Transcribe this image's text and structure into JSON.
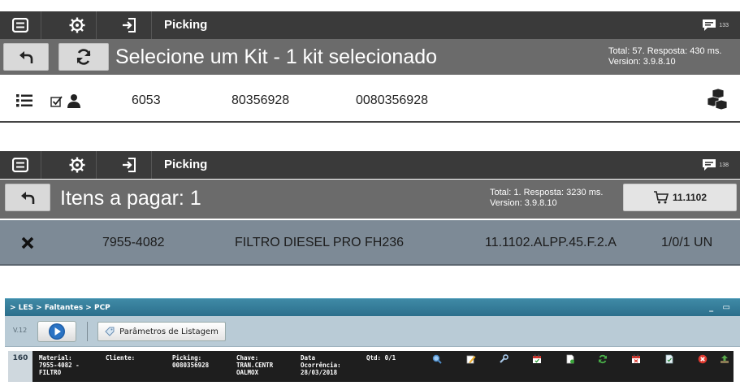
{
  "panel1": {
    "topbar": {
      "title": "Picking",
      "badge": "133",
      "icons": [
        "menu-icon",
        "gear-icon",
        "sign-in-icon",
        "chat-icon"
      ]
    },
    "header": {
      "title": "Selecione um Kit - 1 kit selecionado",
      "info_line1": "Total: 57. Resposta: 430 ms.",
      "info_line2": "Version: 3.9.8.10"
    },
    "row": {
      "code": "6053",
      "material": "80356928",
      "picking": "0080356928"
    }
  },
  "panel2": {
    "topbar": {
      "title": "Picking",
      "badge": "138"
    },
    "header": {
      "title": "Itens a pagar: 1",
      "info_line1": "Total: 1. Resposta: 3230 ms.",
      "info_line2": "Version: 3.9.8.10",
      "cart_label": "11.1102"
    },
    "row": {
      "part": "7955-4082",
      "description": "FILTRO DIESEL PRO FH236",
      "location": "11.1102.ALPP.45.F.2.A",
      "quantity": "1/0/1 UN"
    }
  },
  "panel3": {
    "breadcrumb": "> LES > Faltantes > PCP",
    "window_controls": "_ ▭",
    "version": "V.12",
    "params_button": "Parâmetros de Listagem",
    "row": {
      "number": "160",
      "material_label": "Material:",
      "material_value1": "7955-4082 -",
      "material_value2": "FILTRO",
      "cliente_label": "Cliente:",
      "picking_label": "Picking:",
      "picking_value": "0080356928",
      "chave_label": "Chave:",
      "chave_value1": "TRAN.CENTR",
      "chave_value2": "OALMOX",
      "data_label": "Data",
      "data_label2": "Ocorrência:",
      "data_value": "28/03/2018",
      "qtd": "Qtd: 0/1"
    },
    "action_icons": [
      "search-icon",
      "edit-icon",
      "wrench-icon",
      "calendar-icon",
      "document-icon",
      "refresh-icon",
      "calendar-icon",
      "document-check-icon",
      "cancel-icon",
      "upload-icon"
    ],
    "colors": {
      "titlebar": "#2c6f8c",
      "toolbar": "#b9cbd6",
      "row": "#1e1e1e"
    }
  },
  "colors": {
    "topbar": "#3a3a3a",
    "headerbar": "#6b6b6b",
    "selected_row": "#7d8a96"
  }
}
